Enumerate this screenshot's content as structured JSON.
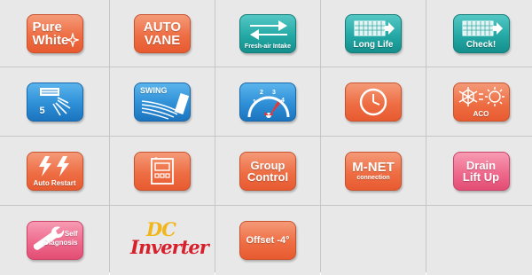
{
  "icons": {
    "pure_white": {
      "line1": "Pure",
      "line2": "White"
    },
    "auto_vane": {
      "line1": "AUTO",
      "line2": "VANE"
    },
    "fresh_air": {
      "label": "Fresh-air Intake"
    },
    "long_life": {
      "label": "Long Life"
    },
    "check": {
      "label": "Check!"
    },
    "fan_steps": {
      "label": "5"
    },
    "swing": {
      "label": "SWING"
    },
    "fan_speed": {
      "marks": [
        "1",
        "2",
        "3",
        "4"
      ]
    },
    "timer": {},
    "aco": {
      "label": "ACO"
    },
    "auto_restart": {
      "label": "Auto Restart"
    },
    "controller": {},
    "group_control": {
      "line1": "Group",
      "line2": "Control"
    },
    "m_net": {
      "line1": "M-NET",
      "line2": "connection"
    },
    "drain_lift": {
      "line1": "Drain",
      "line2": "Lift Up"
    },
    "self_diagnosis": {
      "line1": "Self",
      "line2": "Diagnosis"
    },
    "dc_inverter": {
      "line1": "DC",
      "line2": "Inverter"
    },
    "offset": {
      "label": "Offset -4°"
    }
  },
  "colors": {
    "orange": "#ee6e44",
    "teal": "#24a9a6",
    "blue": "#2e8fd7",
    "pink": "#ee6a8d",
    "dc_yellow": "#f2b51a",
    "inverter_red": "#d8202c"
  }
}
